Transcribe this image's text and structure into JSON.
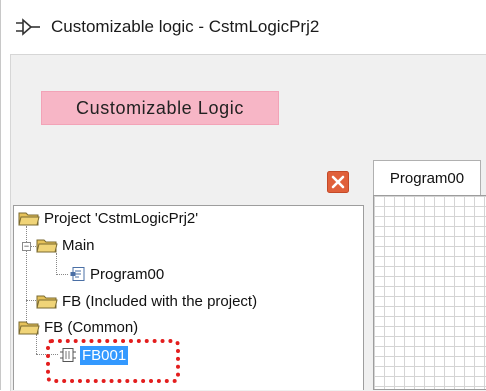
{
  "window": {
    "title": "Customizable logic - CstmLogicPrj2"
  },
  "banner": {
    "label": "Customizable Logic"
  },
  "tree": {
    "project_label": "Project 'CstmLogicPrj2'",
    "main_label": "Main",
    "program_label": "Program00",
    "fb_included_label": "FB (Included with the project)",
    "fb_common_label": "FB (Common)",
    "fb_item_label": "FB001"
  },
  "editor": {
    "tab_label": "Program00"
  },
  "colors": {
    "banner_bg": "#f7b6c6",
    "close_button": "#e0603a",
    "selection": "#3399ff",
    "highlight_border": "#e31e1e",
    "folder": "#f0d478"
  },
  "icons": {
    "title": "logic-plug-icon",
    "close": "close-icon",
    "folder": "folder-icon",
    "program": "program-icon",
    "function_block": "function-block-icon"
  }
}
